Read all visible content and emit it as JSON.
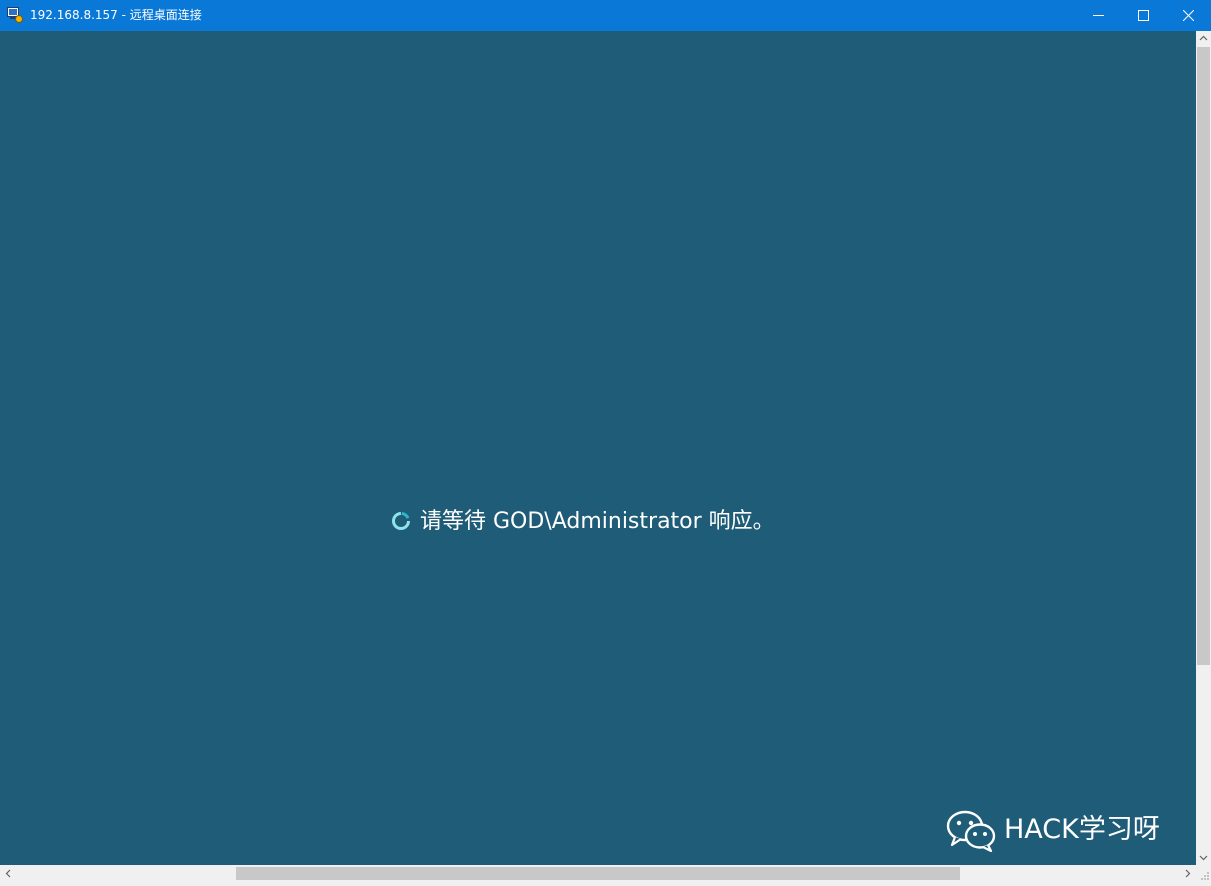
{
  "window": {
    "title": "192.168.8.157 - 远程桌面连接",
    "app_icon": "remote-desktop-icon",
    "controls": {
      "minimize_icon": "minimize-icon",
      "maximize_icon": "maximize-icon",
      "close_icon": "close-icon"
    },
    "titlebar_color": "#0a78d7"
  },
  "remote_session": {
    "background_color": "#1f5c78",
    "status_icon": "loading-spinner-icon",
    "status_message": "请等待 GOD\\Administrator 响应。"
  },
  "watermark": {
    "icon": "wechat-icon",
    "text": "HACK学习呀"
  },
  "scrollbars": {
    "vertical": {
      "up_icon": "arrow-up-icon",
      "down_icon": "arrow-down-icon"
    },
    "horizontal": {
      "left_icon": "arrow-left-icon",
      "right_icon": "arrow-right-icon"
    }
  }
}
